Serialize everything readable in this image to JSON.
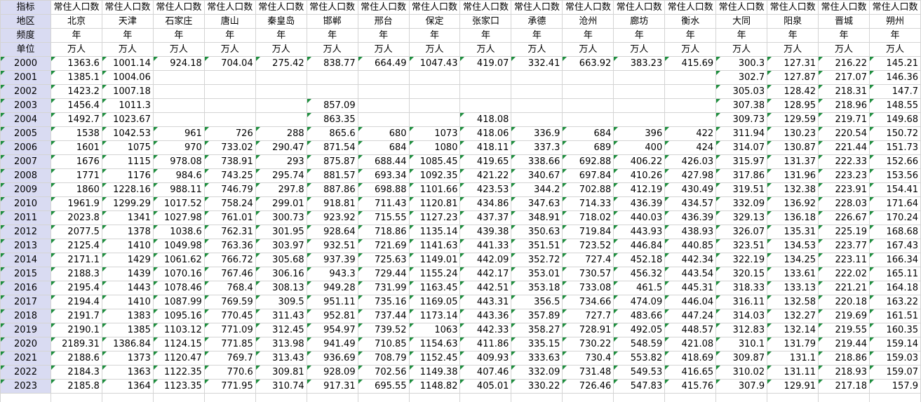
{
  "row_labels": {
    "indicator": "指标",
    "region": "地区",
    "frequency": "频度",
    "unit": "单位"
  },
  "regions": [
    "北京",
    "天津",
    "石家庄",
    "唐山",
    "秦皇岛",
    "邯郸",
    "邢台",
    "保定",
    "张家口",
    "承德",
    "沧州",
    "廊坊",
    "衡水",
    "大同",
    "阳泉",
    "晋城",
    "朔州"
  ],
  "indicator_name": "常住人口数",
  "frequency_value": "年",
  "unit_value": "万人",
  "years": [
    "2000",
    "2001",
    "2002",
    "2003",
    "2004",
    "2005",
    "2006",
    "2007",
    "2008",
    "2009",
    "2010",
    "2011",
    "2012",
    "2013",
    "2014",
    "2015",
    "2016",
    "2017",
    "2018",
    "2019",
    "2020",
    "2021",
    "2022",
    "2023"
  ],
  "values": [
    [
      "1363.6",
      "1001.14",
      "924.18",
      "704.04",
      "275.42",
      "838.77",
      "664.49",
      "1047.43",
      "419.07",
      "332.41",
      "663.92",
      "383.23",
      "415.69",
      "300.3",
      "127.31",
      "216.22",
      "145.21"
    ],
    [
      "1385.1",
      "1004.06",
      "",
      "",
      "",
      "",
      "",
      "",
      "",
      "",
      "",
      "",
      "",
      "302.7",
      "127.87",
      "217.07",
      "146.36"
    ],
    [
      "1423.2",
      "1007.18",
      "",
      "",
      "",
      "",
      "",
      "",
      "",
      "",
      "",
      "",
      "",
      "305.03",
      "128.42",
      "218.31",
      "147.7"
    ],
    [
      "1456.4",
      "1011.3",
      "",
      "",
      "",
      "857.09",
      "",
      "",
      "",
      "",
      "",
      "",
      "",
      "307.38",
      "128.95",
      "218.96",
      "148.55"
    ],
    [
      "1492.7",
      "1023.67",
      "",
      "",
      "",
      "863.35",
      "",
      "",
      "418.08",
      "",
      "",
      "",
      "",
      "309.73",
      "129.59",
      "219.71",
      "149.68"
    ],
    [
      "1538",
      "1042.53",
      "961",
      "726",
      "288",
      "865.6",
      "680",
      "1073",
      "418.06",
      "336.9",
      "684",
      "396",
      "422",
      "311.94",
      "130.23",
      "220.54",
      "150.72"
    ],
    [
      "1601",
      "1075",
      "970",
      "733.02",
      "290.47",
      "871.54",
      "684",
      "1080",
      "418.11",
      "337.3",
      "689",
      "400",
      "424",
      "314.07",
      "130.87",
      "221.44",
      "151.73"
    ],
    [
      "1676",
      "1115",
      "978.08",
      "738.91",
      "293",
      "875.87",
      "688.44",
      "1085.45",
      "419.65",
      "338.66",
      "692.88",
      "406.22",
      "426.03",
      "315.97",
      "131.37",
      "222.33",
      "152.66"
    ],
    [
      "1771",
      "1176",
      "984.6",
      "743.25",
      "295.74",
      "881.57",
      "693.34",
      "1092.35",
      "421.22",
      "340.67",
      "697.84",
      "410.26",
      "427.98",
      "317.86",
      "131.96",
      "223.23",
      "153.56"
    ],
    [
      "1860",
      "1228.16",
      "988.11",
      "746.79",
      "297.8",
      "887.86",
      "698.88",
      "1101.66",
      "423.53",
      "344.2",
      "702.88",
      "412.19",
      "430.49",
      "319.51",
      "132.38",
      "223.91",
      "154.41"
    ],
    [
      "1961.9",
      "1299.29",
      "1017.52",
      "758.24",
      "299.01",
      "918.81",
      "711.43",
      "1120.81",
      "434.86",
      "347.63",
      "714.33",
      "436.39",
      "434.57",
      "332.09",
      "136.92",
      "228.03",
      "171.64"
    ],
    [
      "2023.8",
      "1341",
      "1027.98",
      "761.01",
      "300.73",
      "923.92",
      "715.55",
      "1127.23",
      "437.37",
      "348.91",
      "718.02",
      "440.03",
      "436.39",
      "329.13",
      "136.18",
      "226.67",
      "170.24"
    ],
    [
      "2077.5",
      "1378",
      "1038.6",
      "762.31",
      "301.95",
      "928.64",
      "718.86",
      "1135.14",
      "439.38",
      "350.63",
      "719.84",
      "443.93",
      "438.93",
      "326.07",
      "135.31",
      "225.19",
      "168.68"
    ],
    [
      "2125.4",
      "1410",
      "1049.98",
      "763.36",
      "303.97",
      "932.51",
      "721.69",
      "1141.63",
      "441.33",
      "351.51",
      "723.52",
      "446.84",
      "440.85",
      "323.51",
      "134.53",
      "223.77",
      "167.43"
    ],
    [
      "2171.1",
      "1429",
      "1061.62",
      "766.72",
      "305.68",
      "937.39",
      "725.63",
      "1149.01",
      "442.09",
      "352.72",
      "727.4",
      "452.18",
      "442.34",
      "322.19",
      "134.25",
      "223.11",
      "166.34"
    ],
    [
      "2188.3",
      "1439",
      "1070.16",
      "767.46",
      "306.16",
      "943.3",
      "729.44",
      "1155.24",
      "442.17",
      "353.01",
      "730.57",
      "456.32",
      "443.54",
      "320.15",
      "133.61",
      "222.02",
      "165.11"
    ],
    [
      "2195.4",
      "1443",
      "1078.46",
      "768.4",
      "308.13",
      "949.28",
      "731.99",
      "1163.45",
      "442.51",
      "353.18",
      "733.08",
      "461.5",
      "445.31",
      "318.33",
      "133.13",
      "221.21",
      "164.18"
    ],
    [
      "2194.4",
      "1410",
      "1087.99",
      "769.59",
      "309.5",
      "951.11",
      "735.16",
      "1169.05",
      "443.31",
      "356.5",
      "734.66",
      "474.09",
      "446.04",
      "316.11",
      "132.58",
      "220.18",
      "163.22"
    ],
    [
      "2191.7",
      "1383",
      "1095.16",
      "770.45",
      "311.43",
      "952.81",
      "737.44",
      "1173.14",
      "443.36",
      "357.89",
      "727.7",
      "483.66",
      "447.24",
      "314.03",
      "132.27",
      "219.69",
      "161.51"
    ],
    [
      "2190.1",
      "1385",
      "1103.12",
      "771.09",
      "312.45",
      "954.97",
      "739.52",
      "1063",
      "442.33",
      "358.27",
      "728.91",
      "492.05",
      "448.57",
      "312.83",
      "132.14",
      "219.55",
      "160.35"
    ],
    [
      "2189.31",
      "1386.84",
      "1124.15",
      "771.85",
      "313.98",
      "941.49",
      "710.85",
      "1154.63",
      "411.86",
      "335.15",
      "730.22",
      "548.59",
      "421.08",
      "310.1",
      "131.79",
      "219.44",
      "159.14"
    ],
    [
      "2188.6",
      "1373",
      "1120.47",
      "769.7",
      "313.43",
      "936.69",
      "708.79",
      "1152.45",
      "409.93",
      "333.63",
      "730.4",
      "553.82",
      "418.69",
      "309.87",
      "131.1",
      "218.86",
      "159.03"
    ],
    [
      "2184.3",
      "1363",
      "1122.35",
      "770.6",
      "309.81",
      "928.09",
      "702.56",
      "1149.38",
      "407.46",
      "332.09",
      "731.48",
      "549.53",
      "416.65",
      "310.02",
      "131.11",
      "218.93",
      "159.07"
    ],
    [
      "2185.8",
      "1364",
      "1123.35",
      "771.95",
      "310.74",
      "917.31",
      "695.55",
      "1148.82",
      "405.01",
      "330.22",
      "726.46",
      "547.83",
      "415.76",
      "307.9",
      "129.91",
      "217.18",
      "157.9"
    ]
  ]
}
